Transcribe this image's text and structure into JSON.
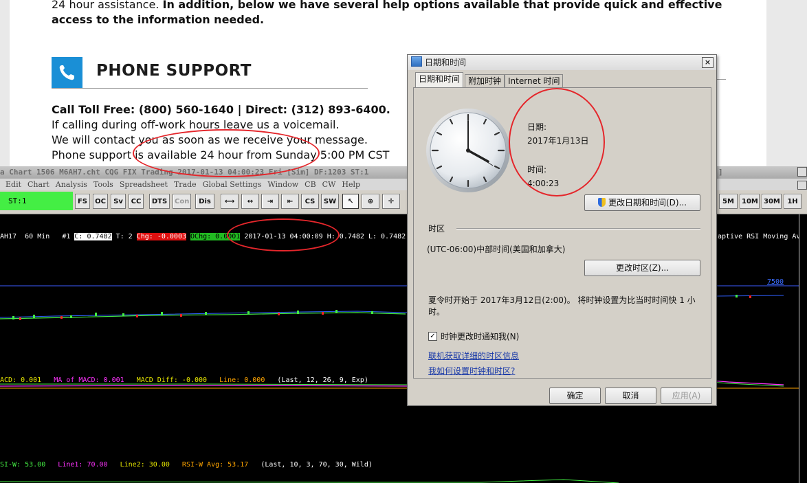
{
  "web": {
    "intro_line_prefix": "24 hour assistance.",
    "intro_line_bold": "In addition, below we have several help options available that provide quick and effective",
    "intro_line_2": "access to the information needed.",
    "section_title": "PHONE SUPPORT",
    "contact_line": "Call Toll Free: (800) 560-1640 | Direct: (312) 893-6400.",
    "line_2": "If calling during off-work hours leave us a voicemail.",
    "line_3": "We will contact you as soon as we receive your message.",
    "line_4": "Phone support is available 24 hour from Sunday 5:00 PM CST"
  },
  "cqg": {
    "title": "a Chart 1506 M6AH7.cht  CQG FIX Trading 2017-01-13  04:00:23 Fri [Sim]  DF:1203  ST:1",
    "title_right": "]",
    "menu": [
      "Edit",
      "Chart",
      "Analysis",
      "Tools",
      "Spreadsheet",
      "Trade",
      "Global Settings",
      "Window",
      "CB",
      "CW",
      "Help"
    ],
    "st_label": "ST:1",
    "toolbar": [
      "FS",
      "OC",
      "Sv",
      "CC",
      "DTS",
      "Con",
      "Dis",
      "CS",
      "SW"
    ],
    "intervals": [
      "5M",
      "10M",
      "30M",
      "1H"
    ],
    "bar_info": {
      "symbol": "AH17",
      "interval": "60 Min",
      "num": "#1",
      "close": "C: 0.7482",
      "ticks": "T: 2",
      "chg": "Chg: -0.0003",
      "ochg": "OChg: 0.0001",
      "time": "2017-01-13 04:00:09",
      "high": "H: 0.7482",
      "low": "L: 0.7482",
      "right_label": "aptive RSI Moving Av"
    },
    "price_level": "7500",
    "macd": {
      "macd": "ACD: 0.001",
      "ma": "MA of MACD: 0.001",
      "diff": "MACD Diff: -0.000",
      "line": "Line: 0.000",
      "params": "(Last, 12, 26, 9, Exp)"
    },
    "rsi": {
      "rsi": "SI-W: 53.00",
      "line1": "Line1: 70.00",
      "line2": "Line2: 30.00",
      "avg": "RSI-W Avg: 53.17",
      "params": "(Last, 10, 3, 70, 30, Wild)"
    },
    "colors": {
      "green": "#44ee44",
      "yellow": "#e6e600",
      "magenta": "#ff33ff",
      "red": "#ff2222",
      "orange": "#ffa500"
    }
  },
  "dialog": {
    "title": "日期和时间",
    "close": "×",
    "tabs": [
      "日期和时间",
      "附加时钟",
      "Internet 时间"
    ],
    "date_label": "日期:",
    "date_value": "2017年1月13日",
    "time_label": "时间:",
    "time_value": "4:00:23",
    "change_datetime_button": "更改日期和时间(D)...",
    "timezone_heading": "时区",
    "timezone_value": "(UTC-06:00)中部时间(美国和加拿大)",
    "change_timezone_button": "更改时区(Z)...",
    "dst_line_1": "夏令时开始于 2017年3月12日(2:00)。 将时钟设置为比当时时间快 1 小",
    "dst_line_2": "时。",
    "notify_checkbox": "时钟更改时通知我(N)",
    "link_1": "联机获取详细的时区信息",
    "link_2": "我如何设置时钟和时区?",
    "ok_button": "确定",
    "cancel_button": "取消",
    "apply_button": "应用(A)"
  }
}
